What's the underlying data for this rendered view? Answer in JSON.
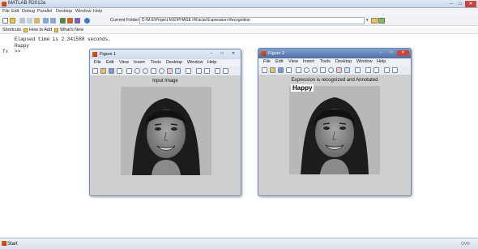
{
  "window": {
    "title": "MATLAB R2012a",
    "min": "–",
    "max": "□",
    "close": "✕"
  },
  "menubar": [
    "File",
    "Edit",
    "Debug",
    "Parallel",
    "Desktop",
    "Window",
    "Help"
  ],
  "toolbar": {
    "current_folder_label": "Current Folder:",
    "current_folder_path": "D:\\M.E\\Project M.E\\PHASE II\\Facial Expression Recognition",
    "dropdown_glyph": "▾"
  },
  "shortcuts": {
    "label": "Shortcuts",
    "how_to_add": "How to Add",
    "whats_new": "What's New"
  },
  "command_window": {
    "fx": "fx",
    "lines": [
      "Elapsed time is 2.341588 seconds.",
      "Happy",
      ">>"
    ]
  },
  "figure1": {
    "title": "Figure 1",
    "menu": [
      "File",
      "Edit",
      "View",
      "Insert",
      "Tools",
      "Desktop",
      "Window",
      "Help"
    ],
    "axes_title": "Input Image",
    "ctl": [
      "–",
      "□",
      "✕"
    ]
  },
  "figure2": {
    "title": "Figure 2",
    "menu": [
      "File",
      "Edit",
      "View",
      "Insert",
      "Tools",
      "Desktop",
      "Window",
      "Help"
    ],
    "axes_title": "Expression is recognized and Annotated",
    "annotation": "Happy",
    "ctl": [
      "–",
      "□",
      "✕"
    ]
  },
  "statusbar": {
    "start_label": "Start",
    "mode": "OVR"
  },
  "colors": {
    "accent": "#e8641b",
    "figure2_frame": "#5a7cac",
    "close_red": "#c9463d"
  }
}
